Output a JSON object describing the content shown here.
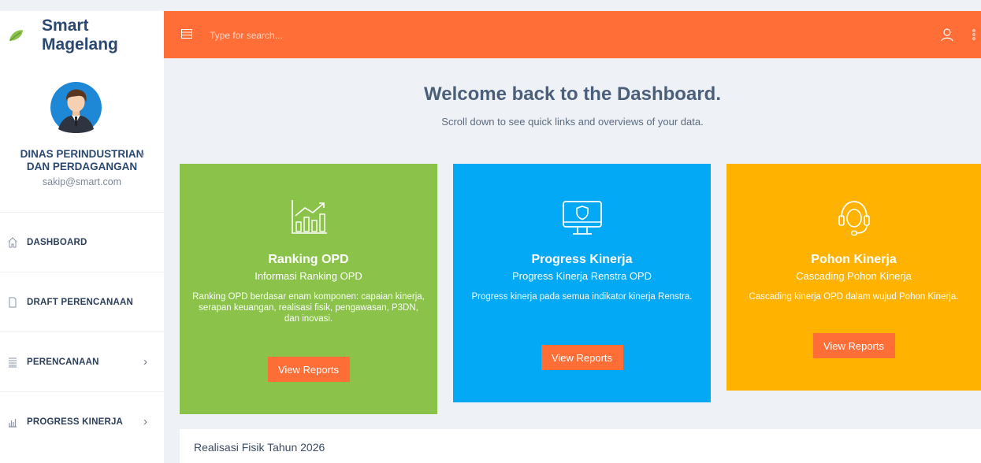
{
  "brand": {
    "name": "Smart Magelang"
  },
  "user": {
    "name_line1": "DINAS PERINDUSTRIAN",
    "name_line2": "DAN PERDAGANGAN",
    "email": "sakip@smart.com"
  },
  "nav": [
    {
      "label": "DASHBOARD",
      "icon": "home-icon"
    },
    {
      "label": "DRAFT PERENCANAAN",
      "icon": "document-icon"
    },
    {
      "label": "PERENCANAAN",
      "icon": "list-icon",
      "chevron": "›"
    },
    {
      "label": "PROGRESS KINERJA",
      "icon": "chart-icon",
      "chevron": "›"
    }
  ],
  "search": {
    "placeholder": "Type for search..."
  },
  "welcome": {
    "title": "Welcome back to the Dashboard.",
    "subtitle": "Scroll down to see quick links and overviews of your data."
  },
  "cards": [
    {
      "title": "Ranking OPD",
      "subtitle": "Informasi Ranking OPD",
      "description": "Ranking OPD berdasar enam komponen: capaian kinerja, serapan keuangan, realisasi fisik, pengawasan, P3DN, dan inovasi.",
      "button": "View Reports",
      "icon": "bar-chart-icon",
      "color": "#8bc34a"
    },
    {
      "title": "Progress Kinerja",
      "subtitle": "Progress Kinerja Renstra OPD",
      "description": "Progress kinerja pada semua indikator kinerja Renstra.",
      "button": "View Reports",
      "icon": "monitor-shield-icon",
      "color": "#03a9f4"
    },
    {
      "title": "Pohon Kinerja",
      "subtitle": "Cascading Pohon Kinerja",
      "description": "Cascading kinerja OPD dalam wujud Pohon Kinerja.",
      "button": "View Reports",
      "icon": "headset-icon",
      "color": "#ffb300"
    }
  ],
  "panel": {
    "title": "Realisasi Fisik Tahun 2026"
  },
  "colors": {
    "header": "#ff6e37",
    "accent": "#ff6e37",
    "brand_text": "#2b4870"
  }
}
